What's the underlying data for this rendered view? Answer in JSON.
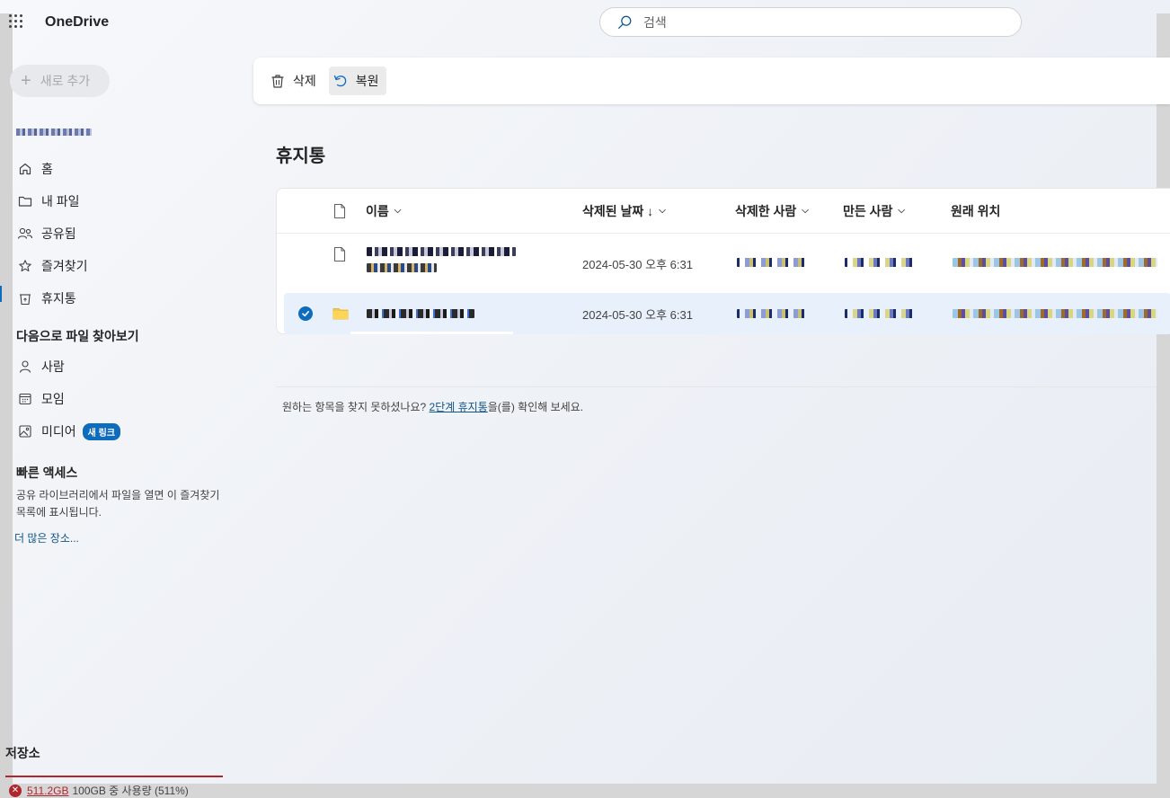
{
  "app": {
    "title": "OneDrive"
  },
  "search": {
    "placeholder": "검색"
  },
  "sidebar": {
    "new_label": "새로 추가",
    "items": [
      {
        "label": "홈",
        "icon": "home-icon"
      },
      {
        "label": "내 파일",
        "icon": "folder-icon"
      },
      {
        "label": "공유됨",
        "icon": "people-icon"
      },
      {
        "label": "즐겨찾기",
        "icon": "star-icon"
      },
      {
        "label": "휴지통",
        "icon": "recycle-bin-icon",
        "active": true
      }
    ],
    "browse_title": "다음으로 파일 찾아보기",
    "browse_items": [
      {
        "label": "사람",
        "icon": "person-icon"
      },
      {
        "label": "모임",
        "icon": "calendar-icon"
      },
      {
        "label": "미디어",
        "icon": "image-icon",
        "badge": "새 링크"
      }
    ],
    "quick_title": "빠른 액세스",
    "quick_desc": "공유 라이브러리에서 파일을 열면 이 즐겨찾기 목록에 표시됩니다.",
    "more_link": "더 많은 장소..."
  },
  "storage": {
    "title": "저장소",
    "used": "511.2GB",
    "detail": "100GB 중 사용량 (511%)"
  },
  "toolbar": {
    "delete_label": "삭제",
    "restore_label": "복원"
  },
  "page": {
    "title": "휴지통"
  },
  "table": {
    "columns": {
      "name": "이름",
      "deleted_date": "삭제된 날짜 ↓",
      "deleted_by": "삭제한 사람",
      "created_by": "만든 사람",
      "original_location": "원래 위치"
    },
    "rows": [
      {
        "deleted_date": "2024-05-30 오후 6:31",
        "type": "file",
        "selected": false
      },
      {
        "deleted_date": "2024-05-30 오후 6:31",
        "type": "folder",
        "selected": true
      }
    ]
  },
  "hint": {
    "prefix": "원하는 항목을 찾지 못하셨나요? ",
    "link": "2단계 휴지통",
    "suffix": "을(를) 확인해 보세요."
  },
  "colors": {
    "accent": "#0f6cbd",
    "error": "#b0262f",
    "selected_row": "#e8f1fb"
  }
}
